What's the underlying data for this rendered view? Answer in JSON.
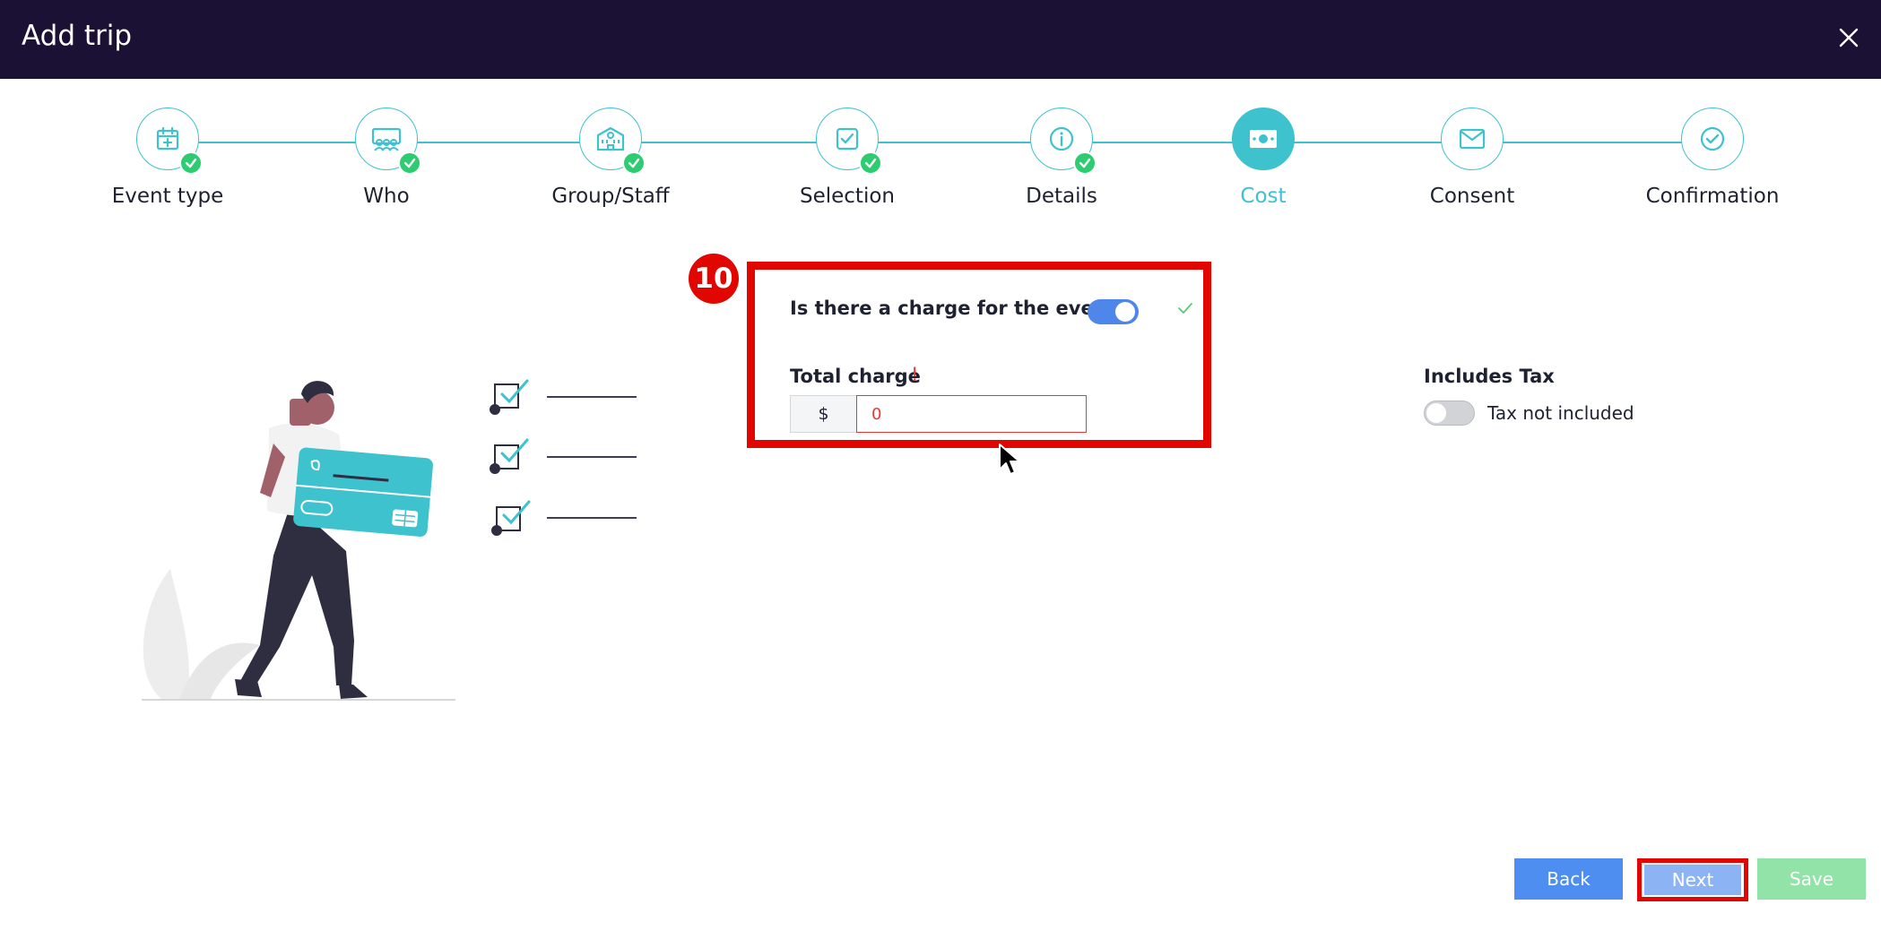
{
  "window": {
    "title": "Add trip",
    "close_icon": "close-icon"
  },
  "stepper": {
    "steps": [
      {
        "label": "Event type",
        "icon": "calendar-plus-icon",
        "state": "done"
      },
      {
        "label": "Who",
        "icon": "group-icon",
        "state": "done"
      },
      {
        "label": "Group/Staff",
        "icon": "building-icon",
        "state": "done"
      },
      {
        "label": "Selection",
        "icon": "checkbox-icon",
        "state": "done"
      },
      {
        "label": "Details",
        "icon": "info-icon",
        "state": "done"
      },
      {
        "label": "Cost",
        "icon": "money-icon",
        "state": "active"
      },
      {
        "label": "Consent",
        "icon": "envelope-icon",
        "state": "pending"
      },
      {
        "label": "Confirmation",
        "icon": "check-circle-icon",
        "state": "pending"
      }
    ],
    "colors": {
      "accent": "#3dc2ce",
      "done": "#2ecc71"
    }
  },
  "annotation": {
    "badge_number": "10",
    "highlight_color": "#e10600"
  },
  "charge": {
    "question": "Is there a charge for the event?",
    "toggle_on": true,
    "total_label": "Total charge",
    "required_mark": "!",
    "currency_symbol": "$",
    "total_value": "0"
  },
  "tax": {
    "title": "Includes Tax",
    "toggle_on": false,
    "status_text": "Tax not included"
  },
  "footer": {
    "back_label": "Back",
    "next_label": "Next",
    "save_label": "Save"
  }
}
